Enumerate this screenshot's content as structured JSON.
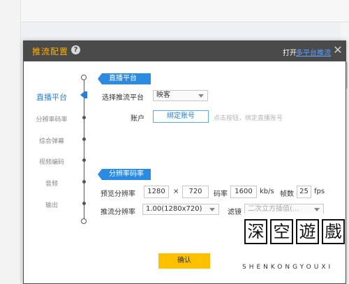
{
  "dialog": {
    "title": "推流配置",
    "open_text": "打开",
    "multi_platform_link": "多平台推流",
    "close_symbol": "✕"
  },
  "nav": {
    "items": [
      {
        "label": "直播平台",
        "active": true
      },
      {
        "label": "分辨率码率"
      },
      {
        "label": "综合弹幕"
      },
      {
        "label": "视频编码"
      },
      {
        "label": "音频"
      },
      {
        "label": "输出"
      }
    ]
  },
  "platform_section": {
    "header": "直播平台",
    "select_label": "选择推流平台",
    "select_value": "映客",
    "account_label": "账户",
    "bind_button": "绑定账号",
    "hint": "点击按钮，绑定直播账号"
  },
  "resolution_section": {
    "header": "分辨率码率",
    "preview_label": "预览分辨率",
    "preview_width": "1280",
    "times": "×",
    "preview_height": "720",
    "bitrate_label": "码率",
    "bitrate_value": "1600",
    "bitrate_unit": "kb/s",
    "fps_label": "帧数",
    "fps_value": "25",
    "fps_unit": "fps",
    "stream_label": "推流分辨率",
    "stream_value": "1.00(1280x720)",
    "filter_label": "滤镜",
    "filter_value": "二次立方插值(..."
  },
  "footer": {
    "confirm": "确认"
  },
  "watermark": {
    "chars": [
      "深",
      "空",
      "遊",
      "戲"
    ],
    "text": "SHENKONGYOUXI"
  },
  "colors": {
    "accent": "#2a8be0",
    "title": "#ffb000",
    "confirm": "#ffc000"
  }
}
